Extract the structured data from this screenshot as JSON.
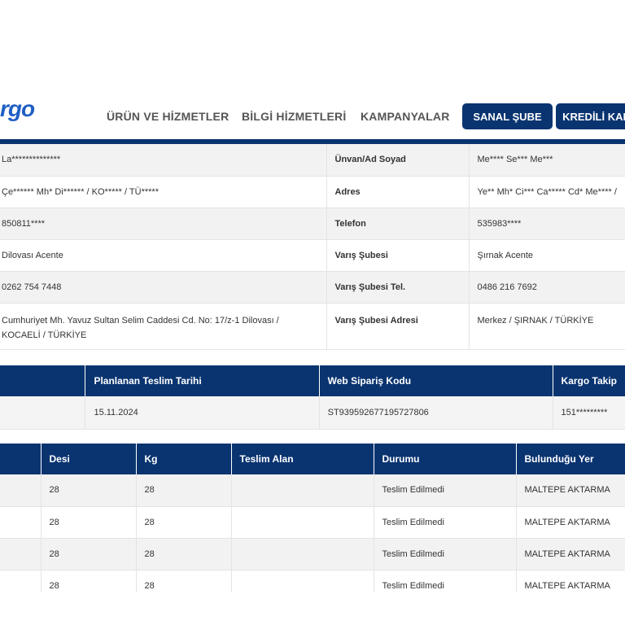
{
  "header": {
    "logo_text": "rgo",
    "nav": [
      "ÜRÜN VE HİZMETLER",
      "BİLGİ HİZMETLERİ",
      "KAMPANYALAR"
    ],
    "buttons": [
      "SANAL ŞUBE",
      "KREDİLİ KAR"
    ]
  },
  "info": {
    "rows": [
      {
        "v1": "La**************",
        "label": "Ünvan/Ad Soyad",
        "v2": "Me**** Se*** Me***"
      },
      {
        "v1": "Çe****** Mh* Di****** / KO***** / TÜ*****",
        "label": "Adres",
        "v2": "Ye** Mh* Ci*** Ca***** Cd* Me**** /"
      },
      {
        "v1": "850811****",
        "label": "Telefon",
        "v2": "535983****"
      },
      {
        "v1": "Dilovası Acente",
        "label": "Varış Şubesi",
        "v2": "Şırnak Acente"
      },
      {
        "v1": "0262 754 7448",
        "label": "Varış Şubesi Tel.",
        "v2": "0486 216 7692"
      },
      {
        "v1": "Cumhuriyet Mh. Yavuz Sultan Selim Caddesi Cd. No: 17/z-1 Dilovası / KOCAELİ / TÜRKİYE",
        "label": "Varış Şubesi Adresi",
        "v2": "Merkez / ŞIRNAK / TÜRKİYE"
      }
    ]
  },
  "delivery": {
    "headers": [
      "",
      "Planlanan Teslim Tarihi",
      "Web Sipariş Kodu",
      "Kargo Takip"
    ],
    "row": [
      "",
      "15.11.2024",
      "ST939592677195727806",
      "151*********"
    ]
  },
  "movements": {
    "headers": [
      "",
      "Desi",
      "Kg",
      "Teslim Alan",
      "Durumu",
      "Bulunduğu Yer"
    ],
    "rows": [
      [
        "",
        "28",
        "28",
        "",
        "Teslim Edilmedi",
        "MALTEPE AKTARMA"
      ],
      [
        "",
        "28",
        "28",
        "",
        "Teslim Edilmedi",
        "MALTEPE AKTARMA"
      ],
      [
        "",
        "28",
        "28",
        "",
        "Teslim Edilmedi",
        "MALTEPE AKTARMA"
      ],
      [
        "",
        "28",
        "28",
        "",
        "Teslim Edilmedi",
        "MALTEPE AKTARMA"
      ]
    ]
  }
}
